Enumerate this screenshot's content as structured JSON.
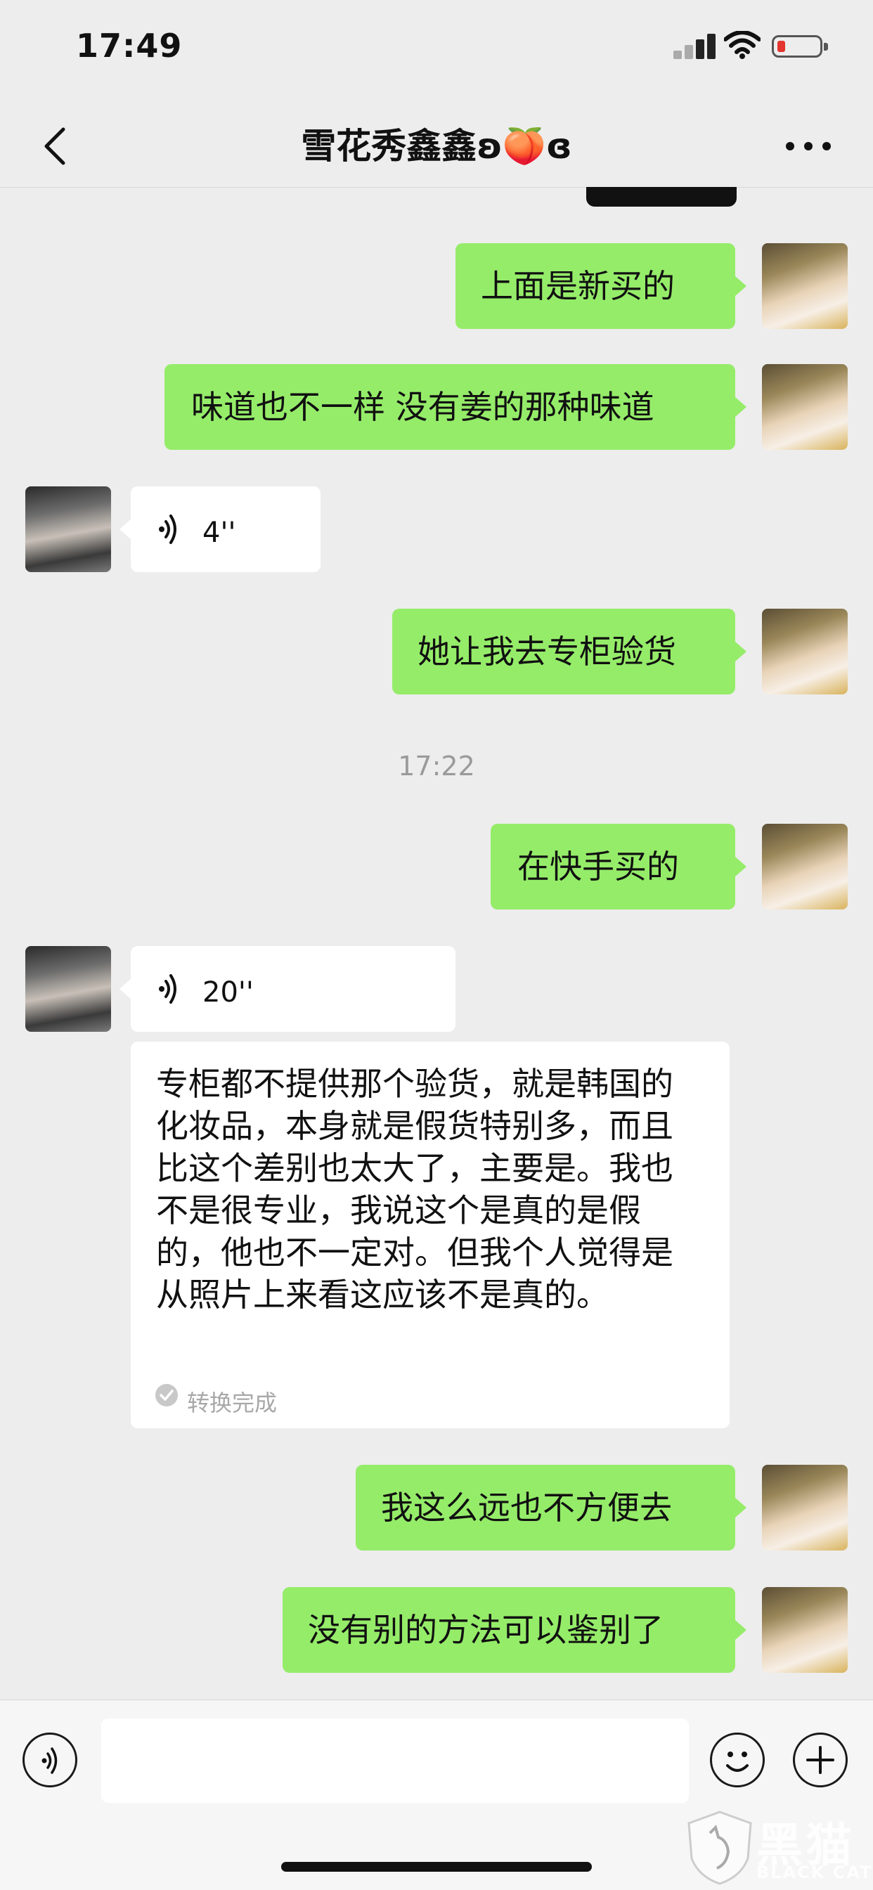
{
  "status_bar": {
    "time": "17:49"
  },
  "nav": {
    "title": "雪花秀鑫鑫ʚ🍑ɞ"
  },
  "messages": {
    "m1": "上面是新买的",
    "m2": "味道也不一样 没有姜的那种味道",
    "m3_voice": "4''",
    "m4": "她让我去专柜验货",
    "timestamp": "17:22",
    "m5": "在快手买的",
    "m6_voice": "20''",
    "m6_transcript": "专柜都不提供那个验货，就是韩国的化妆品，本身就是假货特别多，而且比这个差别也太大了，主要是。我也不是很专业，我说这个是真的是假的，他也不一定对。但我个人觉得是从照片上来看这应该不是真的。",
    "m6_status": "转换完成",
    "m7": "我这么远也不方便去",
    "m8": "没有别的方法可以鉴别了"
  },
  "input": {
    "value": ""
  },
  "watermark": {
    "cn": "黑猫",
    "en": "BLACK CAT"
  },
  "colors": {
    "bubble_out": "#95ec69",
    "bubble_in": "#ffffff",
    "background": "#ededed"
  }
}
